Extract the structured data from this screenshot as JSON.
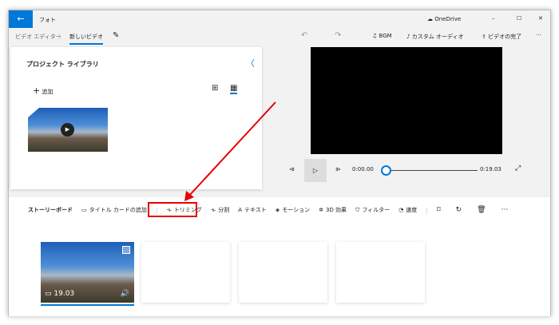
{
  "titlebar": {
    "app": "フォト",
    "onedrive": "OneDrive",
    "back_icon": "arrow-left-icon",
    "minimize": "–",
    "maximize": "☐",
    "close": "✕"
  },
  "toolbar": {
    "breadcrumb_root": "ビデオ エディター",
    "breadcrumb_sep": "〉",
    "project_name": "新しいビデオ",
    "bgm": "BGM",
    "custom_audio": "カスタム オーディオ",
    "finish": "ビデオの完了",
    "more": "···"
  },
  "library": {
    "title": "プロジェクト ライブラリ",
    "add": "追加",
    "collapse": "〈"
  },
  "player": {
    "current": "0:00.00",
    "duration": "0:19.03",
    "progress": 0
  },
  "storyboard": {
    "title": "ストーリーボード",
    "tools": [
      "タイトル カードの追加",
      "トリミング",
      "分割",
      "テキスト",
      "モーション",
      "3D 効果",
      "フィルター",
      "速度"
    ],
    "more": "···"
  },
  "clips": [
    {
      "duration": "19.03"
    }
  ],
  "annotation": {
    "highlight_color": "#e60000"
  }
}
